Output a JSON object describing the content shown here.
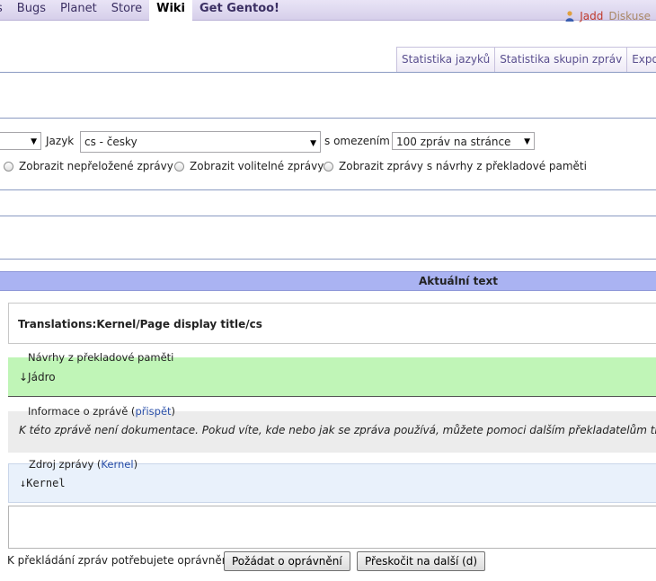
{
  "topnav": {
    "items": [
      {
        "label": "s"
      },
      {
        "label": "Bugs"
      },
      {
        "label": "Planet"
      },
      {
        "label": "Store"
      },
      {
        "label": "Wiki"
      },
      {
        "label": "Get Gentoo!"
      }
    ]
  },
  "user": {
    "name": "Jadd",
    "talk": "Diskuse"
  },
  "tabs": [
    "Statistika jazyků",
    "Statistika skupin zpráv",
    "Expo"
  ],
  "filters": {
    "language_label": "Jazyk",
    "language_value": "cs - česky",
    "limit_label": "s omezením",
    "limit_value": "100 zpráv na stránce"
  },
  "radios": [
    "Zobrazit nepřeložené zprávy",
    "Zobrazit volitelné zprávy",
    "Zobrazit zprávy s návrhy z překladové paměti"
  ],
  "table": {
    "header": "Aktuální text",
    "title": "Translations:Kernel/Page display title/cs"
  },
  "tm": {
    "legend": "Návrhy z překladové paměti",
    "suggestion": "↓Jádro"
  },
  "info": {
    "legend": "Informace o zprávě",
    "link": "přispět",
    "text": "K této zprávě není dokumentace. Pokud víte, kde nebo jak se zpráva používá, můžete pomoci dalším překladatelům tím, "
  },
  "source": {
    "legend": "Zdroj zprávy",
    "link": "Kernel",
    "text": "↓Kernel"
  },
  "footer": {
    "note": "K překládání zpráv potřebujete oprávnění.",
    "request_button": "Požádat o oprávnění",
    "skip_button": "Přeskočit na další (d)"
  },
  "colors": {
    "header_bar": "#aab3f2",
    "tm_bg": "#c0f5b7",
    "info_bg": "#ececec",
    "source_bg": "#e9f1fb"
  }
}
